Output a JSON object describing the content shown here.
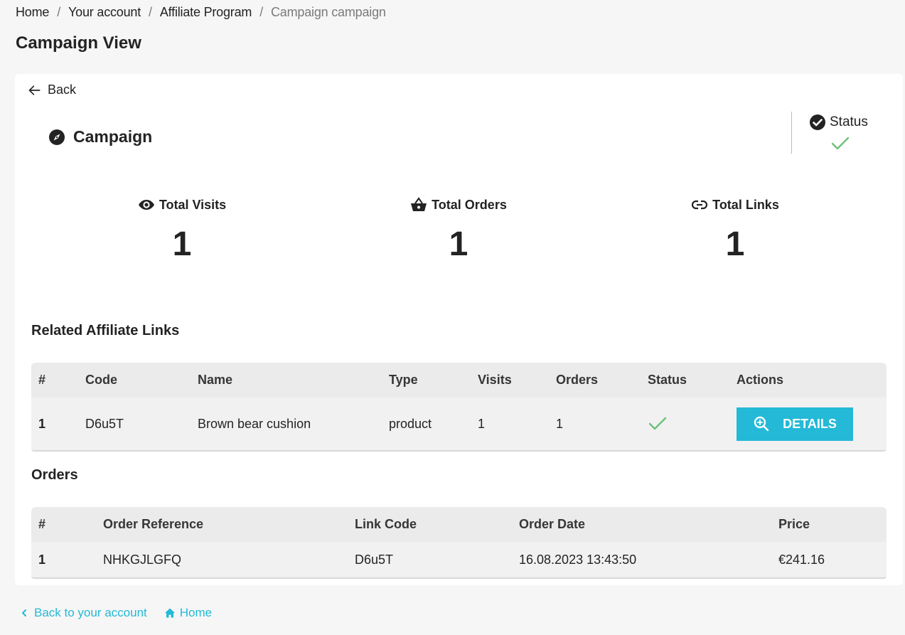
{
  "breadcrumb": {
    "items": [
      {
        "label": "Home"
      },
      {
        "label": "Your account"
      },
      {
        "label": "Affiliate Program"
      },
      {
        "label": "Campaign campaign"
      }
    ],
    "separator": "/"
  },
  "page": {
    "title": "Campaign View"
  },
  "card": {
    "back_label": "Back",
    "campaign_title": "Campaign",
    "status_label": "Status",
    "status_value": "active",
    "stats": [
      {
        "icon": "eye-icon",
        "label": "Total Visits",
        "value": "1"
      },
      {
        "icon": "basket-icon",
        "label": "Total Orders",
        "value": "1"
      },
      {
        "icon": "link-icon",
        "label": "Total Links",
        "value": "1"
      }
    ]
  },
  "links_section": {
    "title": "Related Affiliate Links",
    "columns": [
      "#",
      "Code",
      "Name",
      "Type",
      "Visits",
      "Orders",
      "Status",
      "Actions"
    ],
    "rows": [
      {
        "num": "1",
        "code": "D6u5T",
        "name": "Brown bear cushion",
        "type": "product",
        "visits": "1",
        "orders": "1",
        "status": "active",
        "action_label": "DETAILS"
      }
    ]
  },
  "orders_section": {
    "title": "Orders",
    "columns": [
      "#",
      "Order Reference",
      "Link Code",
      "Order Date",
      "Price"
    ],
    "rows": [
      {
        "num": "1",
        "reference": "NHKGJLGFQ",
        "link_code": "D6u5T",
        "date": "16.08.2023 13:43:50",
        "price": "€241.16"
      }
    ]
  },
  "footer": {
    "back_to_account": "Back to your account",
    "home": "Home"
  },
  "colors": {
    "accent": "#24b9d7",
    "success": "#6cc07a",
    "text": "#232323",
    "background": "#f6f6f6"
  }
}
